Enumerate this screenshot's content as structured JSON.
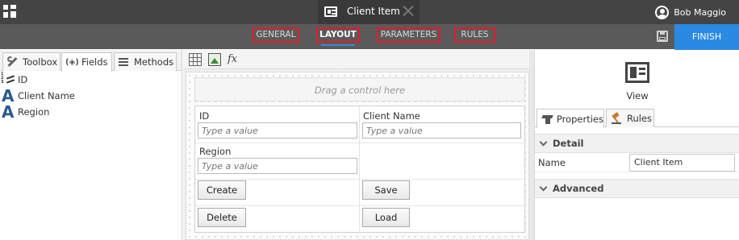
{
  "titlebar": {
    "document_tab": "Client Item",
    "user_name": "Bob Maggio"
  },
  "steps": [
    {
      "label": "GENERAL",
      "active": false
    },
    {
      "label": "LAYOUT",
      "active": true
    },
    {
      "label": "PARAMETERS",
      "active": false
    },
    {
      "label": "RULES",
      "active": false
    }
  ],
  "finish_label": "FINISH",
  "left_panel": {
    "tabs": [
      {
        "label": "Toolbox",
        "icon": "wrench-icon",
        "active": false
      },
      {
        "label": "Fields",
        "icon": "fields-icon",
        "active": true
      },
      {
        "label": "Methods",
        "icon": "methods-icon",
        "active": false
      }
    ],
    "fields": [
      {
        "label": "ID",
        "icon": "number-field-icon"
      },
      {
        "label": "Client Name",
        "icon": "text-field-icon"
      },
      {
        "label": "Region",
        "icon": "text-field-icon"
      }
    ]
  },
  "toolbar_icons": [
    "table-icon",
    "image-icon",
    "expression-icon"
  ],
  "toolbar_fx": "fx",
  "canvas": {
    "drop_hint": "Drag a control here",
    "labels": {
      "id": "ID",
      "client_name": "Client Name",
      "region": "Region"
    },
    "placeholder": "Type a value",
    "buttons": {
      "create": "Create",
      "save": "Save",
      "delete": "Delete",
      "load": "Load"
    }
  },
  "right_panel": {
    "view_label": "View",
    "tabs": [
      {
        "label": "Properties",
        "active": true
      },
      {
        "label": "Rules",
        "active": false
      }
    ],
    "sections": {
      "detail": "Detail",
      "advanced": "Advanced"
    },
    "property": {
      "name": "Name",
      "value": "Client Item"
    }
  },
  "colors": {
    "accent": "#2a8ae2",
    "step_highlight": "#e21b2b",
    "titlebar": "#444444",
    "stepbar": "#5a5a5a"
  }
}
